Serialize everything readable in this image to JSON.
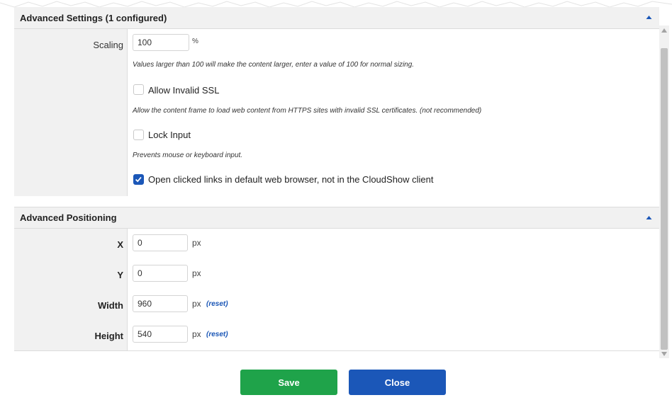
{
  "advanced_settings": {
    "title": "Advanced Settings (1 configured)",
    "scaling": {
      "label": "Scaling",
      "value": "100",
      "unit": "%",
      "hint": "Values larger than 100 will make the content larger, enter a value of 100 for normal sizing."
    },
    "allow_invalid_ssl": {
      "label": "Allow Invalid SSL",
      "checked": false,
      "hint": "Allow the content frame to load web content from HTTPS sites with invalid SSL certificates. (not recommended)"
    },
    "lock_input": {
      "label": "Lock Input",
      "checked": false,
      "hint": "Prevents mouse or keyboard input."
    },
    "open_links": {
      "label": "Open clicked links in default web browser, not in the CloudShow client",
      "checked": true
    }
  },
  "advanced_positioning": {
    "title": "Advanced Positioning",
    "x": {
      "label": "X",
      "value": "0",
      "unit": "px"
    },
    "y": {
      "label": "Y",
      "value": "0",
      "unit": "px"
    },
    "width": {
      "label": "Width",
      "value": "960",
      "unit": "px",
      "reset": "(reset)"
    },
    "height": {
      "label": "Height",
      "value": "540",
      "unit": "px",
      "reset": "(reset)"
    }
  },
  "footer": {
    "save_label": "Save",
    "close_label": "Close"
  },
  "colors": {
    "save": "#1fa34a",
    "close": "#1b57b8",
    "checkbox_checked": "#1b57b8",
    "link": "#1a56b6"
  },
  "icons": {
    "collapse": "chevron-up-icon",
    "check": "check-icon"
  }
}
